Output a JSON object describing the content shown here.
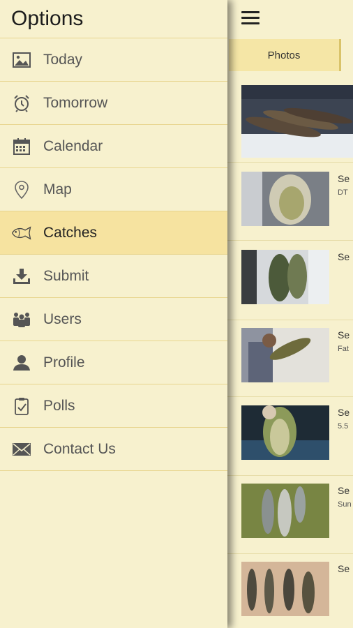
{
  "drawer": {
    "title": "Options",
    "items": [
      {
        "label": "Today",
        "icon": "image-icon"
      },
      {
        "label": "Tomorrow",
        "icon": "alarm-clock-icon"
      },
      {
        "label": "Calendar",
        "icon": "calendar-icon"
      },
      {
        "label": "Map",
        "icon": "map-pin-icon"
      },
      {
        "label": "Catches",
        "icon": "fish-icon",
        "active": true
      },
      {
        "label": "Submit",
        "icon": "download-icon"
      },
      {
        "label": "Users",
        "icon": "users-icon"
      },
      {
        "label": "Profile",
        "icon": "person-icon"
      },
      {
        "label": "Polls",
        "icon": "clipboard-check-icon"
      },
      {
        "label": "Contact Us",
        "icon": "envelope-icon"
      }
    ]
  },
  "content": {
    "tab_label": "Photos",
    "feed": [
      {
        "title": "",
        "subtitle": ""
      },
      {
        "title": "Se",
        "subtitle": "DT"
      },
      {
        "title": "Se",
        "subtitle": ""
      },
      {
        "title": "Se",
        "subtitle": "Fat"
      },
      {
        "title": "Se",
        "subtitle": "5.5"
      },
      {
        "title": "Se",
        "subtitle": "Sun"
      },
      {
        "title": "Se",
        "subtitle": ""
      }
    ]
  },
  "colors": {
    "background": "#f7f1ce",
    "active_item": "#f6e3a0",
    "divider": "#e8d58e",
    "tab": "#f5e6a6"
  }
}
